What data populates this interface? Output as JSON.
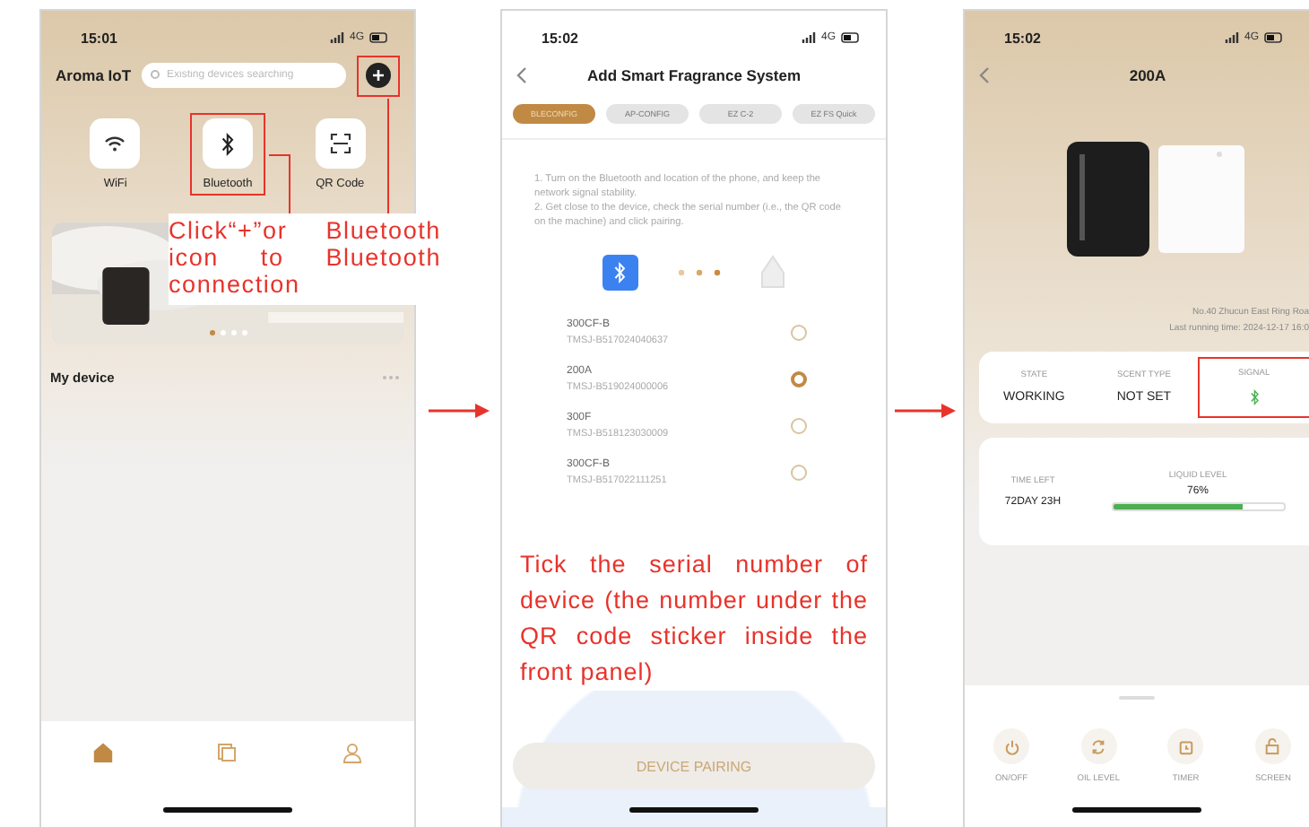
{
  "home_screen": {
    "status_bar": {
      "time": "15:01",
      "network": "4G"
    },
    "title": "Aroma IoT",
    "search": {
      "placeholder": "Existing devices searching"
    },
    "quick_actions": [
      {
        "label": "WiFi",
        "kind": "wifi",
        "highlighted": false
      },
      {
        "label": "Bluetooth",
        "kind": "bluetooth",
        "highlighted": true
      },
      {
        "label": "QR Code",
        "kind": "qr",
        "highlighted": false
      }
    ],
    "add_button": {
      "highlighted": true
    },
    "banner_dots": [
      {
        "selected": true
      },
      {
        "selected": false
      },
      {
        "selected": false
      },
      {
        "selected": false
      }
    ],
    "section_title": "My device",
    "nav": [
      {
        "kind": "home",
        "selected": true
      },
      {
        "kind": "list",
        "selected": false
      },
      {
        "kind": "user",
        "selected": false
      }
    ],
    "callout": "Click“+”or Bluetooth icon to Bluetooth connection"
  },
  "pairing_screen": {
    "status_bar": {
      "time": "15:02",
      "network": "4G"
    },
    "title": "Add Smart Fragrance System",
    "tabs": [
      {
        "label": "BLECONFIG",
        "selected": true
      },
      {
        "label": "AP-CONFIG",
        "selected": false
      },
      {
        "label": "EZ C-2",
        "selected": false
      },
      {
        "label": "EZ FS Quick",
        "selected": false
      }
    ],
    "instructions": [
      "1. Turn on the Bluetooth and location of the phone, and keep the network signal stability.",
      "2. Get close to the device, check the serial number (i.e., the QR code on the machine) and click pairing."
    ],
    "devices": [
      {
        "name": "300CF-B",
        "serial": "TMSJ-B517024040637",
        "selected": false
      },
      {
        "name": "200A",
        "serial": "TMSJ-B519024000006",
        "selected": true
      },
      {
        "name": "300F",
        "serial": "TMSJ-B518123030009",
        "selected": false
      },
      {
        "name": "300CF-B",
        "serial": "TMSJ-B517022111251",
        "selected": false
      }
    ],
    "button": "DEVICE PAIRING",
    "callout": "Tick the serial number of device (the number under the QR code sticker inside the front panel)"
  },
  "device_screen": {
    "status_bar": {
      "time": "15:02",
      "network": "4G"
    },
    "title": "200A",
    "address": "No.40 Zhucun East Ring Roa",
    "last_running": "Last running time: 2024-12-17 16:0",
    "stats": [
      {
        "label": "STATE",
        "kind": "text",
        "value": "WORKING",
        "highlighted": false
      },
      {
        "label": "SCENT TYPE",
        "kind": "text",
        "value": "NOT SET",
        "highlighted": false
      },
      {
        "label": "SIGNAL",
        "kind": "bluetooth",
        "highlighted": true
      }
    ],
    "time_left": {
      "label": "TIME LEFT",
      "value": "72DAY 23H"
    },
    "liquid": {
      "label": "LIQUID LEVEL",
      "reading": "76%",
      "level": 0.76
    },
    "actions": [
      {
        "label": "ON/OFF",
        "kind": "power"
      },
      {
        "label": "OIL LEVEL",
        "kind": "refresh"
      },
      {
        "label": "TIMER",
        "kind": "timer"
      },
      {
        "label": "SCREEN",
        "kind": "lock"
      }
    ]
  }
}
